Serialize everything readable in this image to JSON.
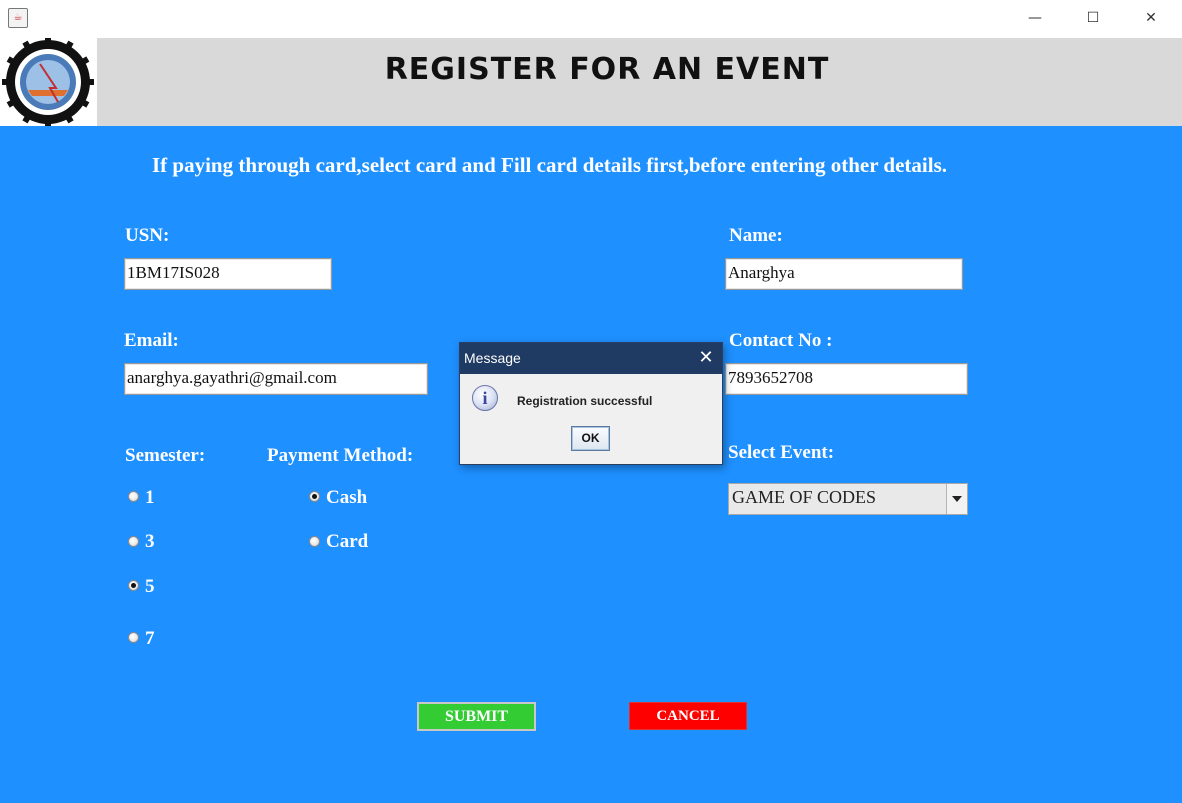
{
  "window": {
    "minimize_glyph": "—",
    "maximize_glyph": "☐",
    "close_glyph": "✕",
    "app_icon": "java-icon"
  },
  "header": {
    "title": "REGISTER FOR AN EVENT",
    "logo": "college-logo-icon"
  },
  "instruction": "If paying through card,select card and  Fill card details first,before entering other details.",
  "form": {
    "usn_label": "USN:",
    "usn_value": "1BM17IS028",
    "name_label": "Name:",
    "name_value": "Anarghya",
    "email_label": "Email:",
    "email_value": "anarghya.gayathri@gmail.com",
    "contact_label": "Contact No :",
    "contact_value": "7893652708",
    "semester_label": "Semester:",
    "semesters": [
      {
        "label": "1",
        "checked": false
      },
      {
        "label": "3",
        "checked": false
      },
      {
        "label": "5",
        "checked": true
      },
      {
        "label": "7",
        "checked": false
      }
    ],
    "payment_label": "Payment Method:",
    "payments": [
      {
        "label": "Cash",
        "checked": true
      },
      {
        "label": "Card",
        "checked": false
      }
    ],
    "event_label": "Select Event:",
    "event_value": "GAME OF CODES",
    "submit_label": "SUBMIT",
    "cancel_label": "CANCEL"
  },
  "dialog": {
    "title": "Message",
    "close_glyph": "✕",
    "icon_glyph": "i",
    "message": "Registration successful",
    "ok_label": "OK"
  }
}
